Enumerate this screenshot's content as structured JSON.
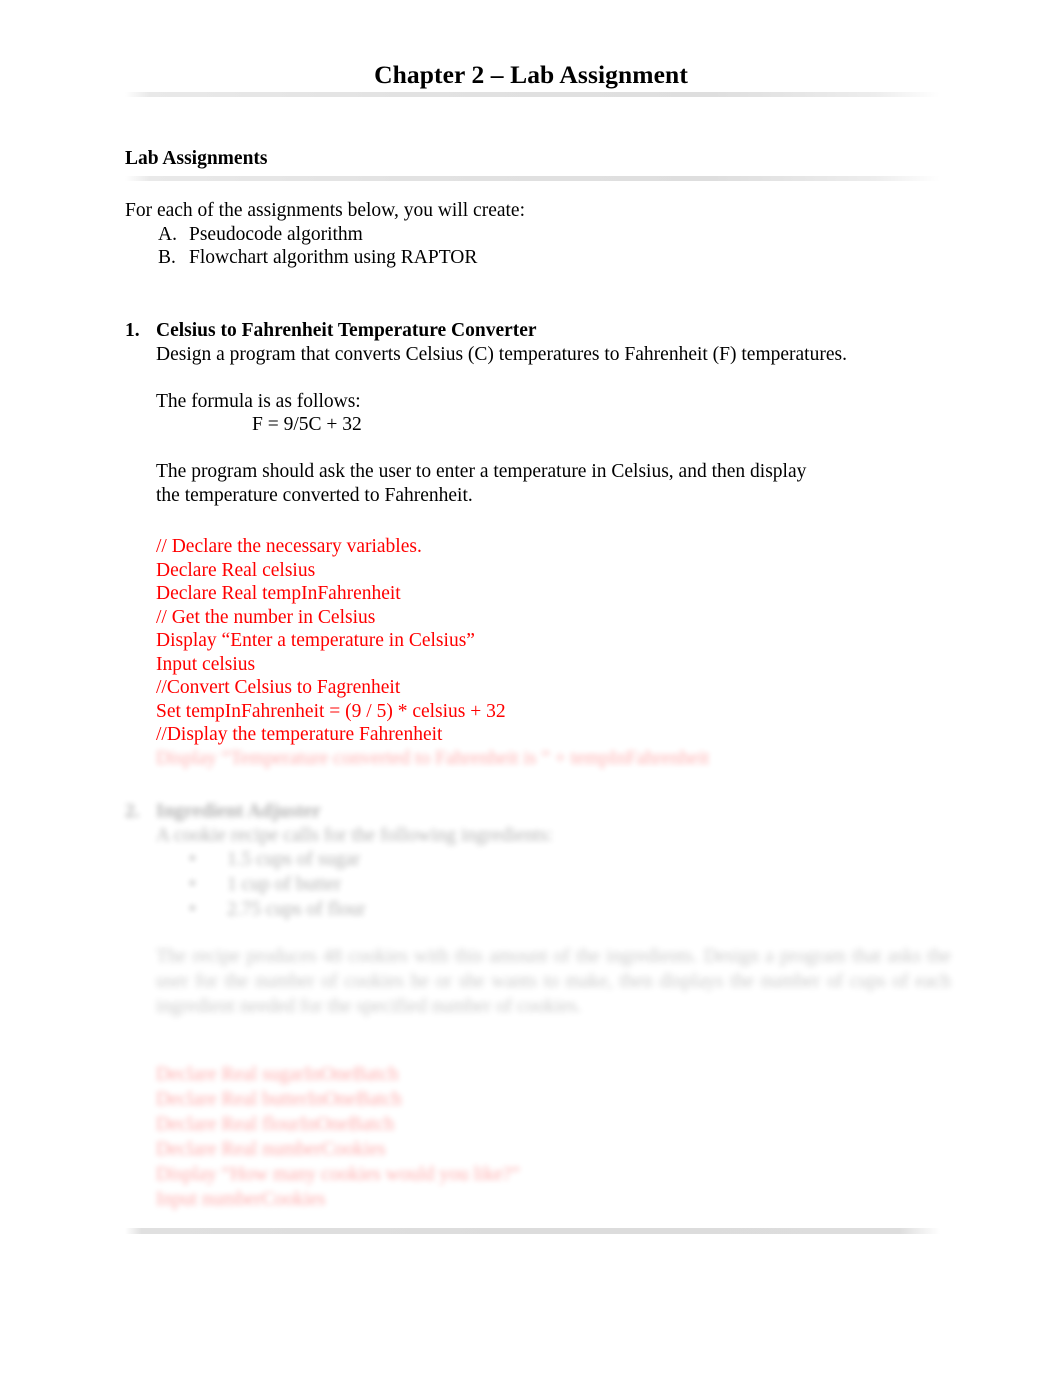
{
  "document": {
    "title": "Chapter 2 – Lab Assignment",
    "section_heading": "Lab Assignments",
    "intro": "For each of the assignments below, you will create:",
    "create_list": [
      {
        "marker": "A.",
        "text": "Pseudocode algorithm"
      },
      {
        "marker": "B.",
        "text": "Flowchart algorithm using RAPTOR"
      }
    ],
    "accent_red": "#ff0000",
    "rule_color": "#dcdcdc"
  },
  "items": [
    {
      "number": "1.",
      "title": "Celsius to Fahrenheit Temperature Converter",
      "description": "Design a program that converts Celsius (C) temperatures to Fahrenheit (F) temperatures.",
      "formula_label": "The formula is as follows:",
      "formula": "F = 9/5C + 32",
      "instruction_line1": "The program should ask the user to enter a temperature in Celsius, and then display",
      "instruction_line2": "the temperature converted to Fahrenheit.",
      "pseudocode": [
        "// Declare the necessary variables.",
        "Declare Real celsius",
        "Declare Real tempInFahrenheit",
        "// Get the number in Celsius",
        "Display “Enter a temperature in Celsius”",
        "Input celsius",
        "//Convert Celsius to Fagrenheit",
        "Set tempInFahrenheit = (9 / 5) * celsius + 32",
        "//Display the temperature Fahrenheit",
        "Display “Temperature converted to Fahrenheit is ” + tempInFahrenheit"
      ]
    },
    {
      "number": "2.",
      "title": "Ingredient Adjuster",
      "description": "A cookie recipe calls for the following ingredients:",
      "sub_items": [
        {
          "marker": "•",
          "text": "1.5 cups of sugar"
        },
        {
          "marker": "•",
          "text": "1 cup of butter"
        },
        {
          "marker": "•",
          "text": "2.75 cups of flour"
        }
      ],
      "paragraph": "The recipe produces 48 cookies with this amount of the ingredients. Design a program that asks the user for the number of cookies he or she wants to make, then displays the number of cups of each ingredient needed for the specified number of cookies.",
      "pseudocode": [
        "Declare Real sugarInOneBatch",
        "Declare Real butterInOneBatch",
        "Declare Real flourInOneBatch",
        "Declare Real numberCookies",
        "Display “How many cookies would you like?”",
        "Input numberCookies"
      ]
    }
  ]
}
